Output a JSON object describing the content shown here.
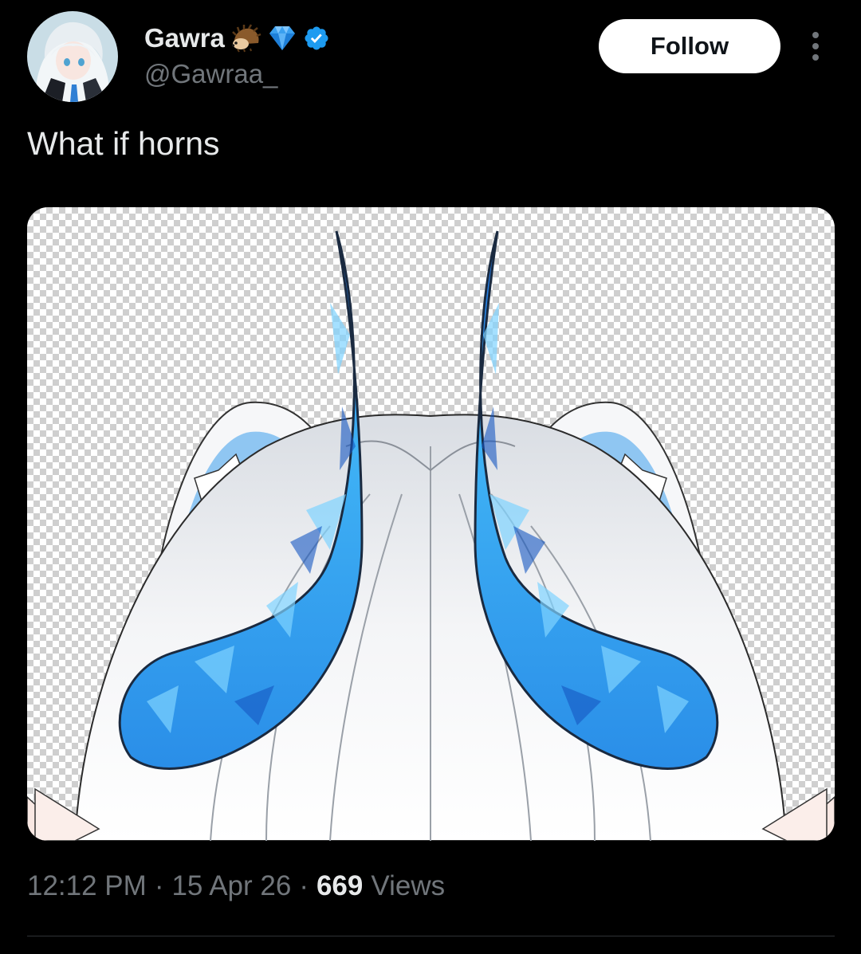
{
  "author": {
    "display_name": "Gawra",
    "handle": "@Gawraa_",
    "badges": [
      "hedgehog-icon",
      "gem-icon",
      "verified-badge-icon"
    ],
    "avatar": "avatar"
  },
  "actions": {
    "follow_label": "Follow",
    "more_icon": "more-options-icon"
  },
  "tweet": {
    "text": "What if horns"
  },
  "media": {
    "alt": "Artwork of a white-haired character with blue crystal horns on a transparent background"
  },
  "meta": {
    "time": "12:12 PM",
    "separator": "·",
    "date": "15 Apr 26",
    "views_count": "669",
    "views_label": "Views"
  },
  "colors": {
    "background": "#000000",
    "text_primary": "#e7e9ea",
    "text_secondary": "#71767b",
    "verified": "#1d9bf0",
    "follow_bg": "#ffffff",
    "divider": "#2f3336"
  }
}
